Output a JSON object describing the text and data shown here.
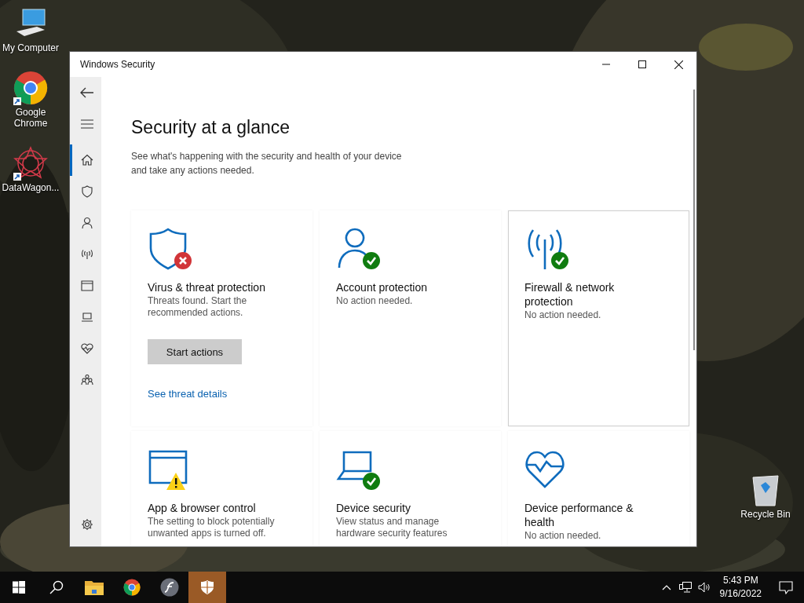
{
  "desktop_icons": [
    {
      "label": "My Computer",
      "shortcut": false
    },
    {
      "label": "Google Chrome",
      "shortcut": true
    },
    {
      "label": "DataWagon...",
      "shortcut": true
    },
    {
      "label": "Recycle Bin",
      "shortcut": false
    }
  ],
  "window": {
    "title": "Windows Security"
  },
  "sidebar": {
    "items": [
      {
        "selected": true
      },
      {
        "selected": false
      },
      {
        "selected": false
      },
      {
        "selected": false
      },
      {
        "selected": false
      },
      {
        "selected": false
      },
      {
        "selected": false
      },
      {
        "selected": false
      }
    ]
  },
  "heading": "Security at a glance",
  "subtitle": "See what's happening with the security and health of your device and take any actions needed.",
  "cards": [
    {
      "title": "Virus & threat protection",
      "description": "Threats found. Start the recommended actions.",
      "button": "Start actions",
      "link": "See threat details",
      "hovered": false
    },
    {
      "title": "Account protection",
      "description": "No action needed.",
      "hovered": false
    },
    {
      "title": "Firewall & network protection",
      "description": "No action needed.",
      "hovered": true
    },
    {
      "title": "App & browser control",
      "description": "The setting to block potentially unwanted apps is turned off.",
      "hovered": false
    },
    {
      "title": "Device security",
      "description": "View status and manage hardware security features",
      "hovered": false
    },
    {
      "title": "Device performance & health",
      "description": "No action needed.",
      "hovered": false
    }
  ],
  "taskbar": {
    "items": [
      {
        "selected": false
      },
      {
        "selected": false
      },
      {
        "selected": false
      },
      {
        "selected": false
      },
      {
        "selected": true
      }
    ],
    "time": "5:43 PM",
    "date": "9/16/2022"
  }
}
